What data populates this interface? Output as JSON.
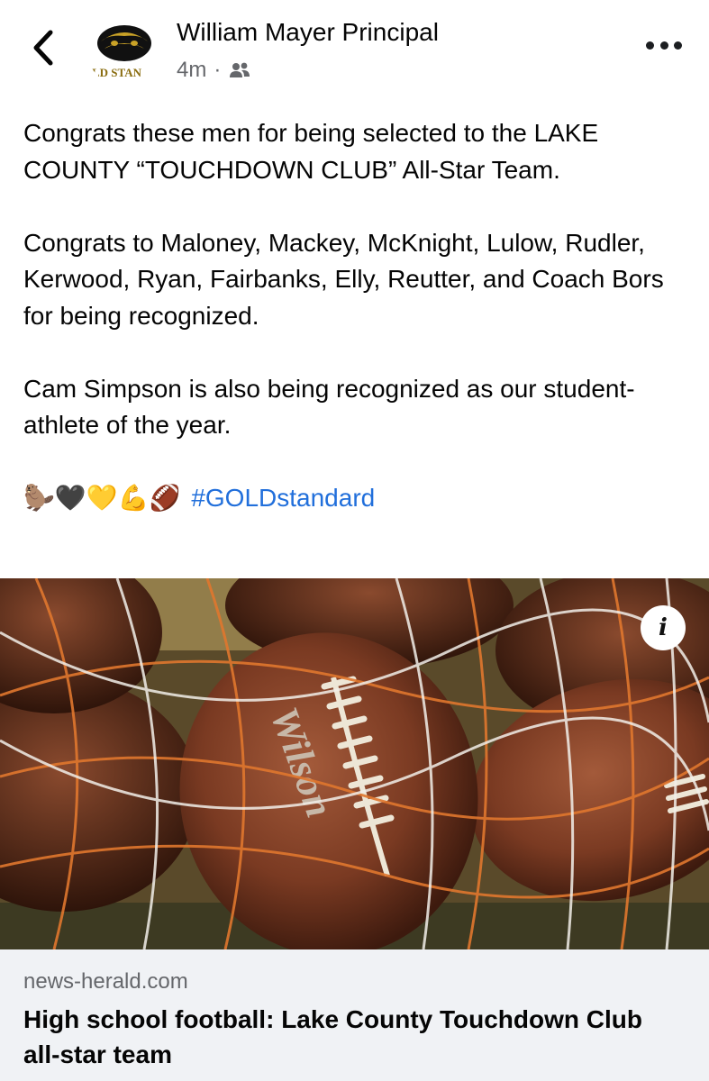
{
  "header": {
    "author": "William Mayer Principal",
    "time": "4m",
    "separator": "·",
    "avatar_text": "LD STAN",
    "back_icon": "chevron-left-icon",
    "audience_icon": "friends-icon",
    "more_icon": "more-icon"
  },
  "post": {
    "paragraphs": [
      "Congrats these men for being selected to the LAKE COUNTY “TOUCHDOWN CLUB” All-Star Team.",
      "Congrats to Maloney, Mackey, McKnight, Lulow, Rudler, Kerwood, Ryan, Fairbanks, Elly, Reutter, and Coach Bors for being recognized.",
      "Cam Simpson is also being recognized as our student-athlete of the year."
    ],
    "emojis": "🦫🖤💛💪🏈",
    "hashtag": "#GOLDstandard"
  },
  "link_card": {
    "domain": "news-herald.com",
    "title": "High school football: Lake County Touchdown Club all-star team",
    "info_label": "i",
    "photo_brand_text": "Wilson"
  },
  "colors": {
    "hashtag": "#216fdb",
    "caption_bg": "#f0f2f5",
    "secondary_text": "#65676b",
    "avatar_gold": "#c9a227"
  }
}
